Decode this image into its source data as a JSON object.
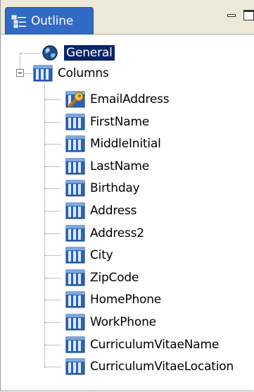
{
  "tab": {
    "label": "Outline",
    "icon": "outline-icon"
  },
  "window_controls": {
    "minimize_icon": "minimize-icon",
    "maximize_icon": "maximize-icon"
  },
  "tree": {
    "general": {
      "label": "General",
      "icon": "globe-icon",
      "selected": true
    },
    "columns": {
      "label": "Columns",
      "icon": "columns-icon",
      "expanded": true
    },
    "items": [
      {
        "label": "EmailAddress",
        "icon": "key-column-icon"
      },
      {
        "label": "FirstName",
        "icon": "column-icon"
      },
      {
        "label": "MiddleInitial",
        "icon": "column-icon"
      },
      {
        "label": "LastName",
        "icon": "column-icon"
      },
      {
        "label": "Birthday",
        "icon": "column-icon"
      },
      {
        "label": "Address",
        "icon": "column-icon"
      },
      {
        "label": "Address2",
        "icon": "column-icon"
      },
      {
        "label": "City",
        "icon": "column-icon"
      },
      {
        "label": "ZipCode",
        "icon": "column-icon"
      },
      {
        "label": "HomePhone",
        "icon": "column-icon"
      },
      {
        "label": "WorkPhone",
        "icon": "column-icon"
      },
      {
        "label": "CurriculumVitaeName",
        "icon": "column-icon"
      },
      {
        "label": "CurriculumVitaeLocation",
        "icon": "column-icon"
      }
    ]
  },
  "colors": {
    "tab_bg": "#316ac5",
    "selection_bg": "#0a246a",
    "chrome_bg": "#ece9d8"
  }
}
